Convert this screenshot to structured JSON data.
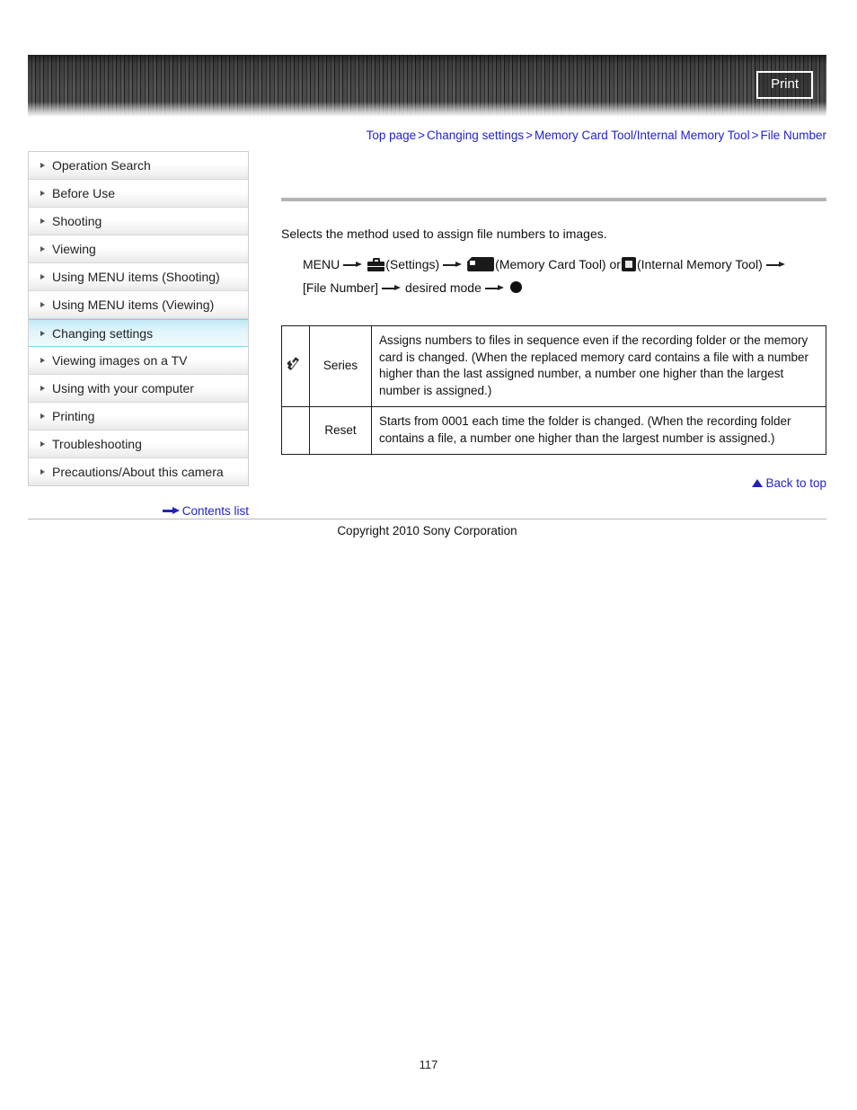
{
  "header": {
    "print_label": "Print"
  },
  "breadcrumb": {
    "items": [
      {
        "label": "Top page"
      },
      {
        "label": "Changing settings"
      },
      {
        "label": "Memory Card Tool/Internal Memory Tool"
      },
      {
        "label": "File Number"
      }
    ],
    "separator": ">"
  },
  "sidebar": {
    "items": [
      {
        "label": "Operation Search",
        "active": false
      },
      {
        "label": "Before Use",
        "active": false
      },
      {
        "label": "Shooting",
        "active": false
      },
      {
        "label": "Viewing",
        "active": false
      },
      {
        "label": "Using MENU items (Shooting)",
        "active": false
      },
      {
        "label": "Using MENU items (Viewing)",
        "active": false
      },
      {
        "label": "Changing settings",
        "active": true
      },
      {
        "label": "Viewing images on a TV",
        "active": false
      },
      {
        "label": "Using with your computer",
        "active": false
      },
      {
        "label": "Printing",
        "active": false
      },
      {
        "label": "Troubleshooting",
        "active": false
      },
      {
        "label": "Precautions/About this camera",
        "active": false
      }
    ],
    "contents_list_label": "Contents list"
  },
  "main": {
    "intro": "Selects the method used to assign file numbers to images.",
    "menu_path": {
      "menu_label": "MENU",
      "settings_label": "(Settings)",
      "memory_card_label": "(Memory Card Tool)",
      "or_label": "or",
      "internal_memory_label": "(Internal Memory Tool)",
      "file_number_label": "[File Number]",
      "desired_mode_label": "desired mode"
    },
    "options": [
      {
        "checked": true,
        "name": "Series",
        "description": "Assigns numbers to files in sequence even if the recording folder or the memory card is changed. (When the replaced memory card contains a file with a number higher than the last assigned number, a number one higher than the largest number is assigned.)"
      },
      {
        "checked": false,
        "name": "Reset",
        "description": "Starts from 0001 each time the folder is changed. (When the recording folder contains a file, a number one higher than the largest number is assigned.)"
      }
    ]
  },
  "footer": {
    "back_to_top_label": "Back to top",
    "copyright": "Copyright 2010 Sony Corporation",
    "page_number": "117"
  },
  "colors": {
    "link": "#2222cc",
    "active_nav": "#bfeaf5",
    "banner": "#3a3a3a"
  }
}
